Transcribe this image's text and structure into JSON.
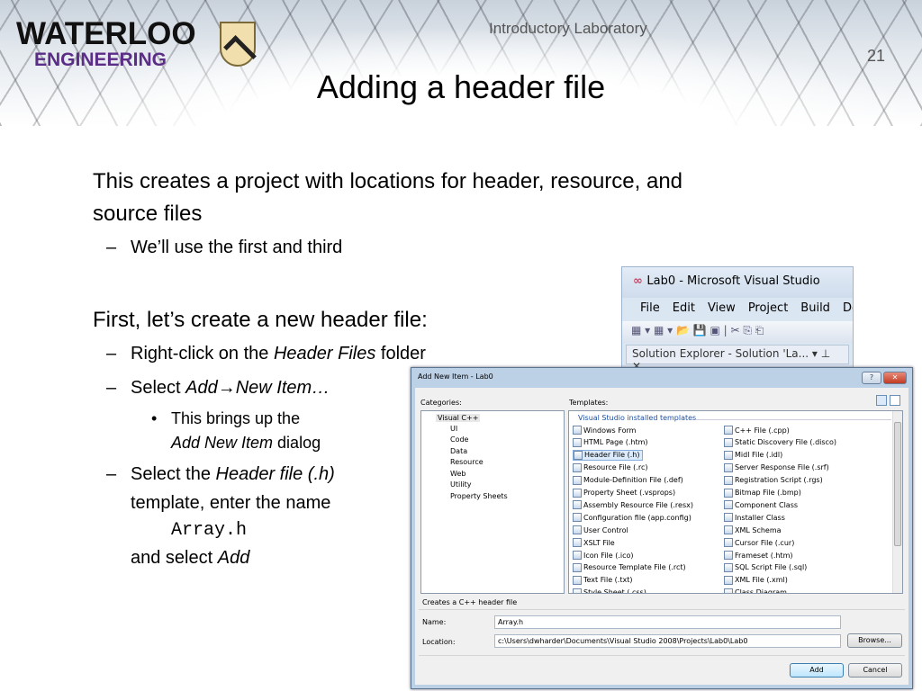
{
  "slide": {
    "logo_line1": "WATERLOO",
    "logo_line2": "ENGINEERING",
    "course": "Introductory Laboratory",
    "page_number": "21",
    "title": "Adding a header file",
    "p1_line1": "This creates a project with locations for header, resource, and",
    "p1_line2": "source files",
    "b1": "We’ll use the first and third",
    "p2": "First, let’s create a new header file:",
    "b2_pre": "Right-click on the ",
    "b2_em": "Header Files",
    "b2_post": " folder",
    "b3_pre": "Select ",
    "b3_em": "Add→New Item…",
    "sub1_line1": "This brings up the",
    "sub1_em": "Add New Item",
    "sub1_post": " dialog",
    "b4_pre": "Select the ",
    "b4_em": "Header file (.h)",
    "b4_line2": "template, enter the name",
    "b4_code": "Array.h",
    "b4_line4_pre": "and select ",
    "b4_line4_em": "Add",
    "dash": "–",
    "dot": "•"
  },
  "vs_window": {
    "title": "Lab0 - Microsoft Visual Studio",
    "menu": [
      "File",
      "Edit",
      "View",
      "Project",
      "Build",
      "De"
    ],
    "solution_explorer": "Solution Explorer - Solution 'La... ▾ ⊥ ✕"
  },
  "dialog": {
    "title": "Add New Item - Lab0",
    "help_label": "?",
    "close_label": "✕",
    "categories_label": "Categories:",
    "categories": [
      "Visual C++",
      "UI",
      "Code",
      "Data",
      "Resource",
      "Web",
      "Utility",
      "Property Sheets"
    ],
    "templates_label": "Templates:",
    "templates_group": "Visual Studio installed templates",
    "templates_col1": [
      "Windows Form",
      "HTML Page (.htm)",
      "Header File (.h)",
      "Resource File (.rc)",
      "Module-Definition File (.def)",
      "Property Sheet (.vsprops)",
      "Assembly Resource File (.resx)",
      "Configuration file (app.config)",
      "User Control",
      "XSLT File",
      "Icon File (.ico)",
      "Resource Template File (.rct)",
      "Text File (.txt)",
      "Style Sheet (.css)"
    ],
    "templates_col2": [
      "C++ File (.cpp)",
      "Static Discovery File (.disco)",
      "Midl File (.idl)",
      "Server Response File (.srf)",
      "Registration Script (.rgs)",
      "Bitmap File (.bmp)",
      "Component Class",
      "Installer Class",
      "XML Schema",
      "Cursor File (.cur)",
      "Frameset (.htm)",
      "SQL Script File (.sql)",
      "XML File (.xml)",
      "Class Diagram"
    ],
    "selected_template": "Header File (.h)",
    "description": "Creates a C++ header file",
    "name_label": "Name:",
    "name_value": "Array.h",
    "location_label": "Location:",
    "location_value": "c:\\Users\\dwharder\\Documents\\Visual Studio 2008\\Projects\\Lab0\\Lab0",
    "browse_label": "Browse...",
    "add_label": "Add",
    "cancel_label": "Cancel"
  }
}
